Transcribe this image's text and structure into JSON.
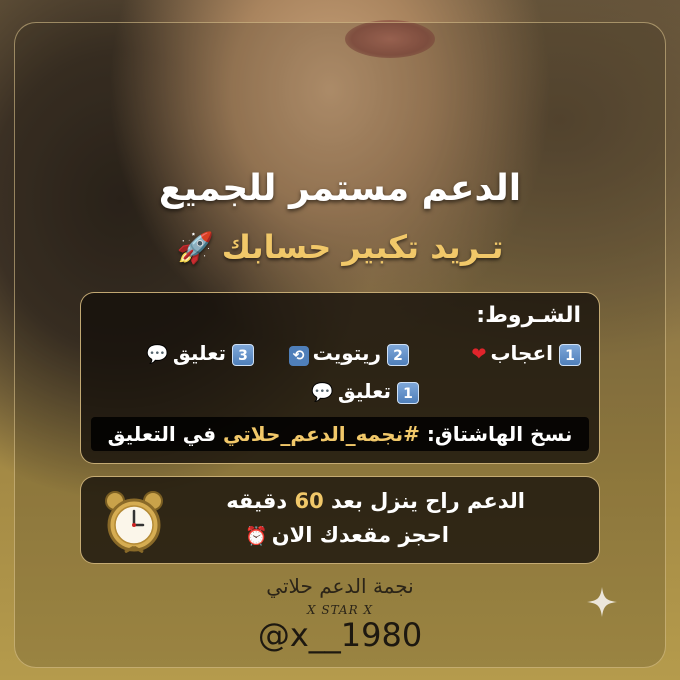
{
  "header": {
    "title": "الدعم مستمر للجميع",
    "subtitle": "تـريد تكبير حسابك",
    "subtitle_icon": "rocket-icon"
  },
  "terms": {
    "heading": "الشـروط:",
    "items": [
      {
        "number": "1",
        "label": "اعجاب",
        "icon": "red-heart-icon"
      },
      {
        "number": "2",
        "label": "ريتويت",
        "icon": "repeat-icon"
      },
      {
        "number": "3",
        "label": "تعليق",
        "icon": "speech-bubble-icon"
      },
      {
        "number": "1",
        "label": "تعليق",
        "icon": "speech-bubble-icon"
      }
    ],
    "hashtag_prefix": "نسخ الهاشتاق: ",
    "hashtag": "#نجمه_الدعم_حلاتي",
    "hashtag_suffix": " في التعليق"
  },
  "support": {
    "line1_prefix": "الدعم راح ينزل بعد ",
    "minutes": "60",
    "line1_suffix": " دقيقه",
    "line2": "احجز مقعدك الان",
    "line2_icon": "alarm-clock-icon",
    "side_icon": "stopwatch-icon"
  },
  "footer": {
    "name": "نجمة الدعم حلاتي",
    "subname": "X STAR X",
    "handle": "@x__1980",
    "corner_icon": "sparkle-icon"
  },
  "colors": {
    "accent": "#f1c869",
    "box_border": "#ebcd8c",
    "text": "#ffffff"
  }
}
